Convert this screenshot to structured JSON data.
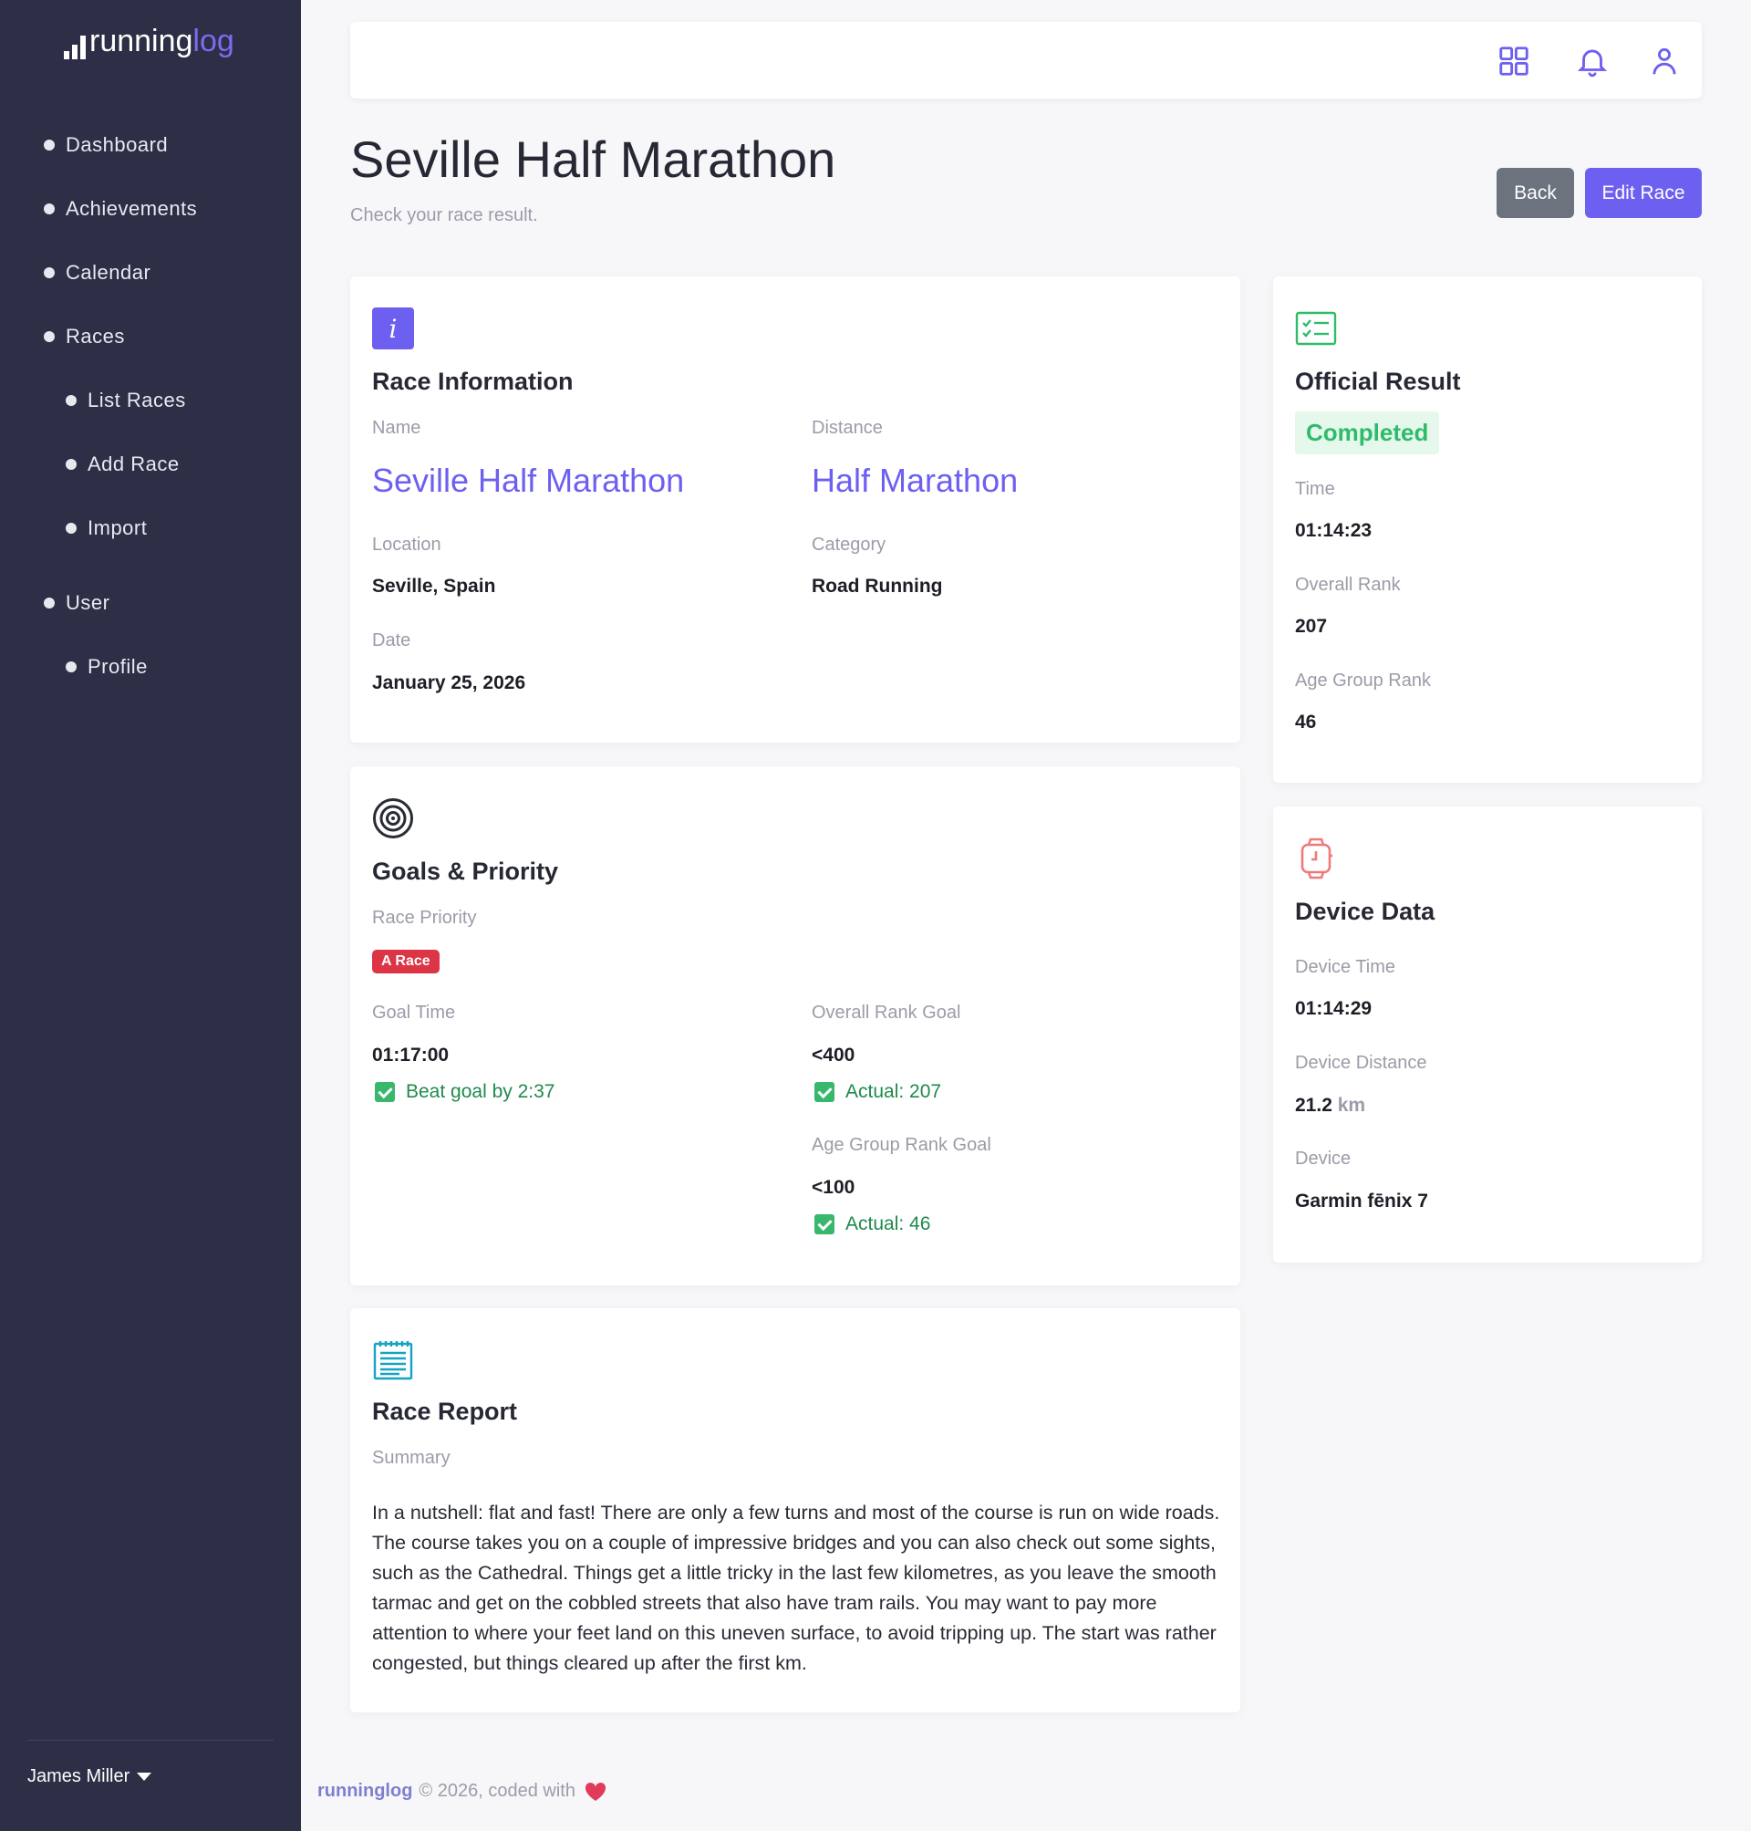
{
  "brand": {
    "part1": "running",
    "part2": "log"
  },
  "nav": {
    "dashboard": "Dashboard",
    "achievements": "Achievements",
    "calendar": "Calendar",
    "races": "Races",
    "list_races": "List Races",
    "add_race": "Add Race",
    "import": "Import",
    "user": "User",
    "profile": "Profile"
  },
  "user_menu": {
    "name": "James Miller"
  },
  "topbar": {
    "icons": [
      "grid-icon",
      "bell-icon",
      "user-icon"
    ],
    "accent": "#6d5ff0"
  },
  "page": {
    "title": "Seville Half Marathon",
    "subtitle": "Check your race result.",
    "back_label": "Back",
    "edit_label": "Edit Race"
  },
  "race_info": {
    "title": "Race Information",
    "name_label": "Name",
    "name": "Seville Half Marathon",
    "distance_label": "Distance",
    "distance": "Half Marathon",
    "location_label": "Location",
    "location": "Seville, Spain",
    "category_label": "Category",
    "category": "Road Running",
    "date_label": "Date",
    "date": "January 25, 2026"
  },
  "goals": {
    "title": "Goals & Priority",
    "priority_label": "Race Priority",
    "priority": "A Race",
    "goal_time_label": "Goal Time",
    "goal_time": "01:17:00",
    "goal_time_result": "Beat goal by 2:37",
    "overall_goal_label": "Overall Rank Goal",
    "overall_goal": "<400",
    "overall_result": "Actual: 207",
    "age_goal_label": "Age Group Rank Goal",
    "age_goal": "<100",
    "age_result": "Actual: 46"
  },
  "report": {
    "title": "Race Report",
    "summary_label": "Summary",
    "summary": "In a nutshell: flat and fast! There are only a few turns and most of the course is run on wide roads. The course takes you on a couple of impressive bridges and you can also check out some sights, such as the Cathedral. Things get a little tricky in the last few kilometres, as you leave the smooth tarmac and get on the cobbled streets that also have tram rails. You may want to pay more attention to where your feet land on this uneven surface, to avoid tripping up. The start was rather congested, but things cleared up after the first km."
  },
  "official": {
    "title": "Official Result",
    "status": "Completed",
    "time_label": "Time",
    "time": "01:14:23",
    "overall_label": "Overall Rank",
    "overall": "207",
    "age_label": "Age Group Rank",
    "age": "46"
  },
  "device": {
    "title": "Device Data",
    "time_label": "Device Time",
    "time": "01:14:29",
    "distance_label": "Device Distance",
    "distance": "21.2",
    "distance_unit": "km",
    "device_label": "Device",
    "device": "Garmin fēnix 7"
  },
  "footer": {
    "brand": "runninglog",
    "text": "© 2026, coded with"
  }
}
